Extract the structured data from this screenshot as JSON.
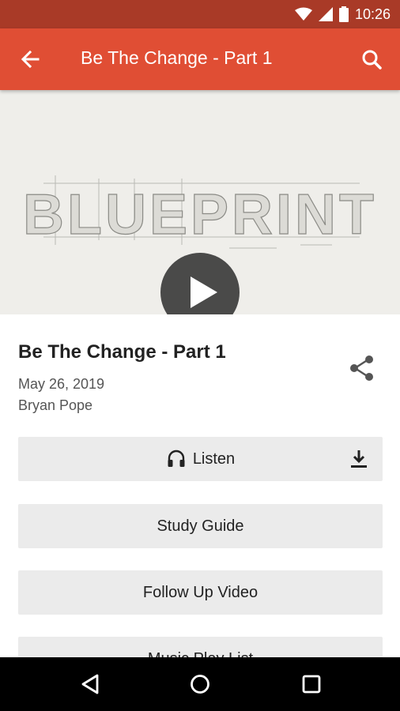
{
  "status_bar": {
    "time": "10:26",
    "icons": [
      "wifi-icon",
      "signal-icon",
      "battery-icon"
    ]
  },
  "app_bar": {
    "title": "Be The Change - Part 1",
    "back_icon": "arrow-back-icon",
    "search_icon": "search-icon"
  },
  "hero": {
    "artwork_text": "BLUEPRINT",
    "play_icon": "play-icon"
  },
  "sermon": {
    "title": "Be The Change - Part 1",
    "date": "May 26, 2019",
    "speaker": "Bryan Pope",
    "share_icon": "share-icon"
  },
  "actions": {
    "listen_label": "Listen",
    "listen_icon": "headphones-icon",
    "download_icon": "download-icon",
    "study_guide_label": "Study Guide",
    "follow_up_label": "Follow Up Video",
    "music_label": "Music Play List"
  },
  "nav_bar": {
    "icons": [
      "back-triangle-icon",
      "home-circle-icon",
      "recents-square-icon"
    ]
  },
  "colors": {
    "app_bar": "#e04e34",
    "status_bar": "#a93a27",
    "button_bg": "#ebebeb",
    "art_dark": "#2f3f46"
  }
}
